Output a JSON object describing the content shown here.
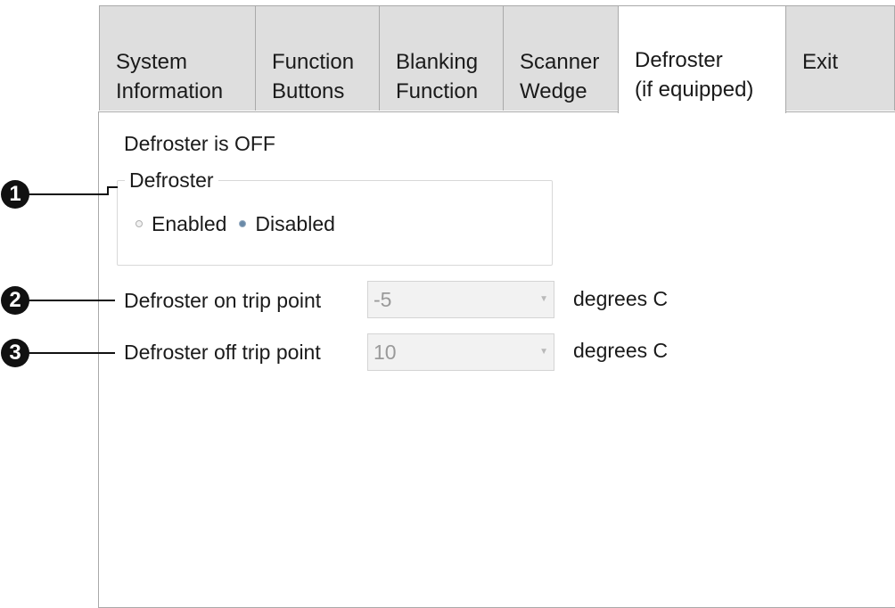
{
  "tabs": [
    {
      "line1": "System",
      "line2": "Information"
    },
    {
      "line1": "Function",
      "line2": "Buttons"
    },
    {
      "line1": "Blanking",
      "line2": "Function"
    },
    {
      "line1": "Scanner",
      "line2": "Wedge"
    },
    {
      "line1": "Defroster",
      "line2": "(if equipped)"
    },
    {
      "line1": "Exit",
      "line2": ""
    }
  ],
  "active_tab": "Defroster (if equipped)",
  "status_text": "Defroster is OFF",
  "defroster_group": {
    "legend": "Defroster",
    "enabled_label": "Enabled",
    "disabled_label": "Disabled",
    "selected": "Disabled"
  },
  "on_trip": {
    "label": "Defroster on trip point",
    "value": "-5",
    "unit": "degrees C"
  },
  "off_trip": {
    "label": "Defroster off trip point",
    "value": "10",
    "unit": "degrees C"
  },
  "callouts": [
    "1",
    "2",
    "3"
  ]
}
